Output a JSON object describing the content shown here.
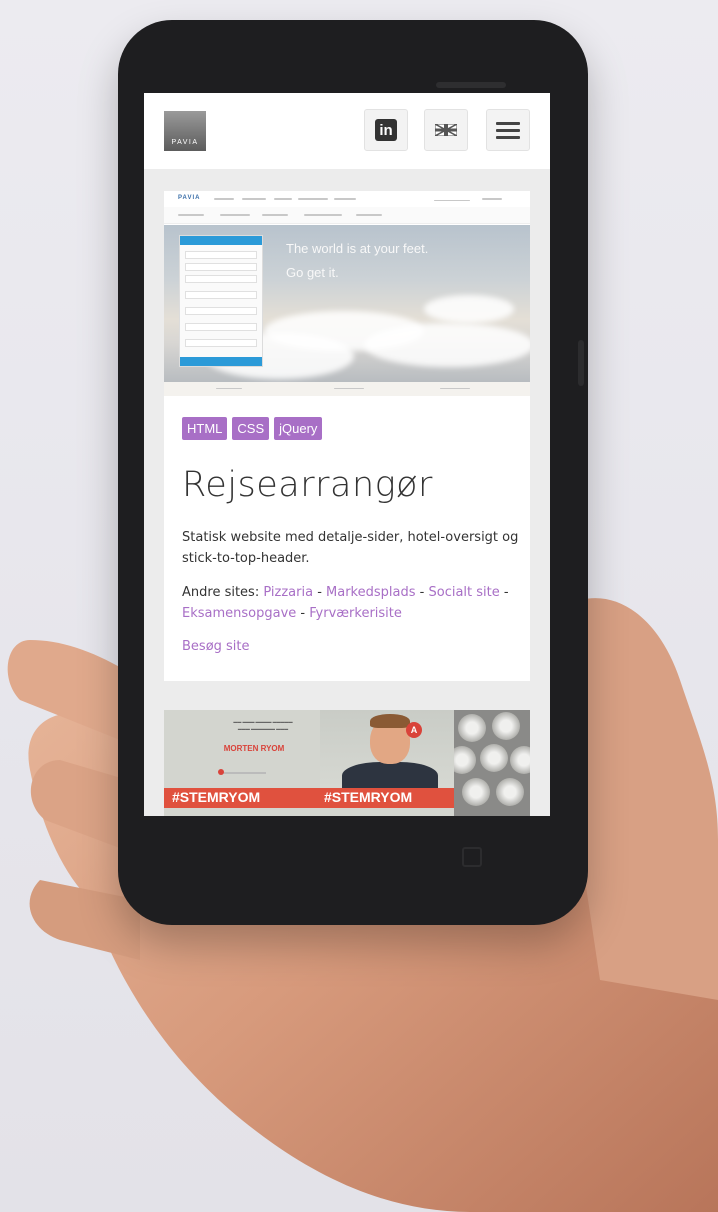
{
  "header": {
    "logo_text": "PAVIA",
    "linkedin_label": "in",
    "icons": [
      "linkedin-icon",
      "uk-flag-icon",
      "hamburger-menu-icon"
    ]
  },
  "project": {
    "preview": {
      "brand": "PAVIA",
      "hero_line1": "The world is at your feet.",
      "hero_line2": "Go get it."
    },
    "tags": [
      "HTML",
      "CSS",
      "jQuery"
    ],
    "title": "Rejsearrangør",
    "description": "Statisk website med detalje-sider, hotel-oversigt og stick-to-top-header.",
    "other_sites_label": "Andre sites:",
    "other_sites": [
      "Pizzaria",
      "Markedsplads",
      "Socialt site",
      "Eksamensopgave",
      "Fyrværkerisite"
    ],
    "separator": " - ",
    "visit_label": "Besøg site"
  },
  "next_project": {
    "name": "MORTEN RYOM",
    "hashtag": "#STEMRYOM",
    "badge": "A"
  },
  "colors": {
    "accent": "#a86fc6",
    "banner_red": "#e0513e",
    "phone_body": "#1e1e20"
  }
}
